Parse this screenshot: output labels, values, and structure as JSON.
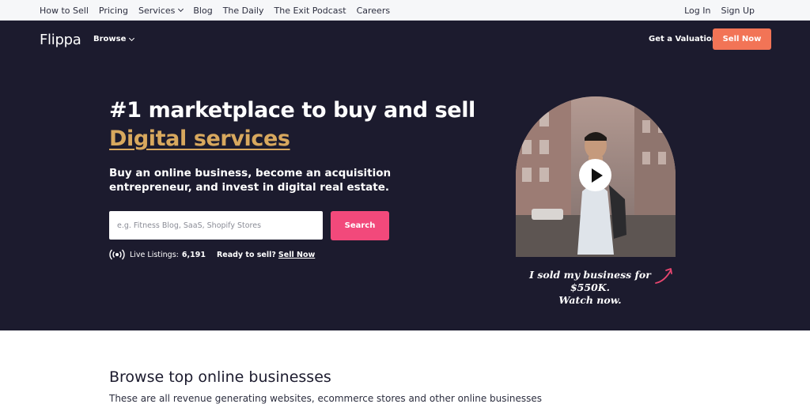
{
  "topnav": {
    "left": [
      "How to Sell",
      "Pricing",
      "Services",
      "Blog",
      "The Daily",
      "The Exit Podcast",
      "Careers"
    ],
    "right": [
      "Log In",
      "Sign Up"
    ]
  },
  "header": {
    "logo": "Flippa",
    "browse": "Browse",
    "valuation": "Get a Valuation",
    "sell_now": "Sell Now"
  },
  "hero": {
    "headline_prefix": "#1 marketplace to buy and sell ",
    "headline_accent": "Digital services",
    "subhead": "Buy an online business, become an acquisition entrepreneur, and invest in digital real estate.",
    "search_placeholder": "e.g. Fitness Blog, SaaS, Shopify Stores",
    "search_button": "Search",
    "live_label": "Live Listings:",
    "live_count": "6,191",
    "ready_label": "Ready to sell?",
    "sell_link": "Sell Now",
    "video_caption_line1": "I sold my business for $550K.",
    "video_caption_line2": "Watch now."
  },
  "section": {
    "title": "Browse top online businesses",
    "description": "These are all revenue generating websites, ecommerce stores and other online businesses"
  },
  "colors": {
    "hero_bg": "#1c1b2e",
    "accent_gold": "#d8a85e",
    "search_pink": "#f2497b",
    "sell_orange": "#f27456",
    "arrow_pink": "#e8466f"
  },
  "icons": [
    "chevron-down-icon",
    "live-signal-icon",
    "play-icon",
    "curved-arrow-icon"
  ]
}
